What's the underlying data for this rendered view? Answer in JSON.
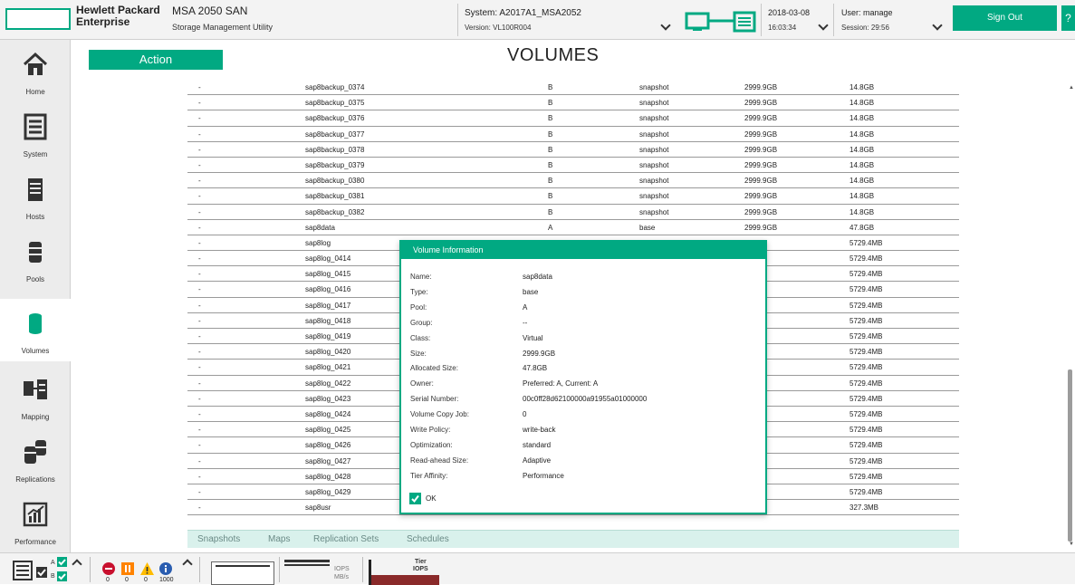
{
  "header": {
    "brand_line1": "Hewlett Packard",
    "brand_line2": "Enterprise",
    "product_title": "MSA 2050 SAN",
    "product_subtitle": "Storage Management Utility",
    "system_label": "System: A2017A1_MSA2052",
    "version_label": "Version: VL100R004",
    "date": "2018-03-08",
    "time": "16:03:34",
    "user_label": "User: manage",
    "session_label": "Session: 29:56",
    "sign_out_label": "Sign Out",
    "help_label": "?",
    "accent_color": "#01a982"
  },
  "sidebar": {
    "items": [
      {
        "label": "Home",
        "icon": "home-icon"
      },
      {
        "label": "System",
        "icon": "system-icon"
      },
      {
        "label": "Hosts",
        "icon": "hosts-icon"
      },
      {
        "label": "Pools",
        "icon": "pools-icon"
      },
      {
        "label": "Volumes",
        "icon": "volumes-icon",
        "active": true
      },
      {
        "label": "Mapping",
        "icon": "mapping-icon"
      },
      {
        "label": "Replications",
        "icon": "replications-icon"
      },
      {
        "label": "Performance",
        "icon": "performance-icon"
      }
    ]
  },
  "main": {
    "action_label": "Action",
    "page_title": "VOLUMES",
    "rows": [
      {
        "group": "-",
        "name": "sap8backup_0374",
        "pool": "B",
        "type": "snapshot",
        "size": "2999.9GB",
        "alloc": "14.8GB"
      },
      {
        "group": "-",
        "name": "sap8backup_0375",
        "pool": "B",
        "type": "snapshot",
        "size": "2999.9GB",
        "alloc": "14.8GB"
      },
      {
        "group": "-",
        "name": "sap8backup_0376",
        "pool": "B",
        "type": "snapshot",
        "size": "2999.9GB",
        "alloc": "14.8GB"
      },
      {
        "group": "-",
        "name": "sap8backup_0377",
        "pool": "B",
        "type": "snapshot",
        "size": "2999.9GB",
        "alloc": "14.8GB"
      },
      {
        "group": "-",
        "name": "sap8backup_0378",
        "pool": "B",
        "type": "snapshot",
        "size": "2999.9GB",
        "alloc": "14.8GB"
      },
      {
        "group": "-",
        "name": "sap8backup_0379",
        "pool": "B",
        "type": "snapshot",
        "size": "2999.9GB",
        "alloc": "14.8GB"
      },
      {
        "group": "-",
        "name": "sap8backup_0380",
        "pool": "B",
        "type": "snapshot",
        "size": "2999.9GB",
        "alloc": "14.8GB"
      },
      {
        "group": "-",
        "name": "sap8backup_0381",
        "pool": "B",
        "type": "snapshot",
        "size": "2999.9GB",
        "alloc": "14.8GB"
      },
      {
        "group": "-",
        "name": "sap8backup_0382",
        "pool": "B",
        "type": "snapshot",
        "size": "2999.9GB",
        "alloc": "14.8GB"
      },
      {
        "group": "-",
        "name": "sap8data",
        "pool": "A",
        "type": "base",
        "size": "2999.9GB",
        "alloc": "47.8GB"
      },
      {
        "group": "-",
        "name": "sap8log",
        "pool": "",
        "type": "",
        "size": "B",
        "alloc": "5729.4MB"
      },
      {
        "group": "-",
        "name": "sap8log_0414",
        "pool": "",
        "type": "",
        "size": "B",
        "alloc": "5729.4MB"
      },
      {
        "group": "-",
        "name": "sap8log_0415",
        "pool": "",
        "type": "",
        "size": "B",
        "alloc": "5729.4MB"
      },
      {
        "group": "-",
        "name": "sap8log_0416",
        "pool": "",
        "type": "",
        "size": "B",
        "alloc": "5729.4MB"
      },
      {
        "group": "-",
        "name": "sap8log_0417",
        "pool": "",
        "type": "",
        "size": "B",
        "alloc": "5729.4MB"
      },
      {
        "group": "-",
        "name": "sap8log_0418",
        "pool": "",
        "type": "",
        "size": "B",
        "alloc": "5729.4MB"
      },
      {
        "group": "-",
        "name": "sap8log_0419",
        "pool": "",
        "type": "",
        "size": "B",
        "alloc": "5729.4MB"
      },
      {
        "group": "-",
        "name": "sap8log_0420",
        "pool": "",
        "type": "",
        "size": "B",
        "alloc": "5729.4MB"
      },
      {
        "group": "-",
        "name": "sap8log_0421",
        "pool": "",
        "type": "",
        "size": "B",
        "alloc": "5729.4MB"
      },
      {
        "group": "-",
        "name": "sap8log_0422",
        "pool": "",
        "type": "",
        "size": "B",
        "alloc": "5729.4MB"
      },
      {
        "group": "-",
        "name": "sap8log_0423",
        "pool": "",
        "type": "",
        "size": "B",
        "alloc": "5729.4MB"
      },
      {
        "group": "-",
        "name": "sap8log_0424",
        "pool": "",
        "type": "",
        "size": "B",
        "alloc": "5729.4MB"
      },
      {
        "group": "-",
        "name": "sap8log_0425",
        "pool": "",
        "type": "",
        "size": "B",
        "alloc": "5729.4MB"
      },
      {
        "group": "-",
        "name": "sap8log_0426",
        "pool": "",
        "type": "",
        "size": "B",
        "alloc": "5729.4MB"
      },
      {
        "group": "-",
        "name": "sap8log_0427",
        "pool": "",
        "type": "",
        "size": "B",
        "alloc": "5729.4MB"
      },
      {
        "group": "-",
        "name": "sap8log_0428",
        "pool": "",
        "type": "",
        "size": "B",
        "alloc": "5729.4MB"
      },
      {
        "group": "-",
        "name": "sap8log_0429",
        "pool": "",
        "type": "",
        "size": "B",
        "alloc": "5729.4MB"
      },
      {
        "group": "-",
        "name": "sap8usr",
        "pool": "",
        "type": "",
        "size": "B",
        "alloc": "327.3MB"
      }
    ],
    "tabs": [
      "Snapshots",
      "Maps",
      "Replication Sets",
      "Schedules"
    ]
  },
  "dialog": {
    "title": "Volume Information",
    "fields": [
      {
        "key": "Name:",
        "value": "sap8data"
      },
      {
        "key": "Type:",
        "value": "base"
      },
      {
        "key": "Pool:",
        "value": "A"
      },
      {
        "key": "Group:",
        "value": "--"
      },
      {
        "key": "Class:",
        "value": "Virtual"
      },
      {
        "key": "Size:",
        "value": "2999.9GB"
      },
      {
        "key": "Allocated Size:",
        "value": "47.8GB"
      },
      {
        "key": "Owner:",
        "value": "Preferred: A, Current: A"
      },
      {
        "key": "Serial Number:",
        "value": "00c0ff28d62100000a91955a01000000"
      },
      {
        "key": "Volume Copy Job:",
        "value": "0"
      },
      {
        "key": "Write Policy:",
        "value": "write-back"
      },
      {
        "key": "Optimization:",
        "value": "standard"
      },
      {
        "key": "Read-ahead Size:",
        "value": "Adaptive"
      },
      {
        "key": "Tier Affinity:",
        "value": "Performance"
      }
    ],
    "ok_label": "OK"
  },
  "footer": {
    "controller_a": "A",
    "controller_b": "B",
    "error_count": "0",
    "critical_count": "0",
    "warning_count": "0",
    "info_count": "1000",
    "iops_label": "IOPS",
    "mbs_label": "MB/s",
    "tier_label": "Tier",
    "tier_iops_label": "IOPS"
  }
}
